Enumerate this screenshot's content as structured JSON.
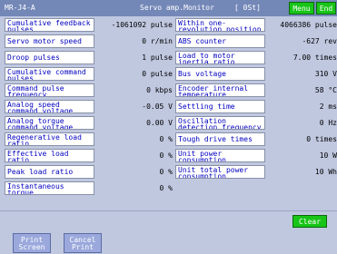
{
  "header": {
    "model": "MR-J4-A",
    "title": "Servo amp.Monitor",
    "status": "[ 0St]",
    "menu_label": "Menu",
    "end_label": "End"
  },
  "left_rows": [
    {
      "label": "Cumulative feedback\npulses",
      "value": "-1061092 pulse"
    },
    {
      "label": "Servo motor speed",
      "value": "0 r/min"
    },
    {
      "label": "Droop pulses",
      "value": "1 pulse"
    },
    {
      "label": "Cumulative command\npulses",
      "value": "0 pulse"
    },
    {
      "label": "Command pulse\nfrequency",
      "value": "0 kbps"
    },
    {
      "label": "Analog speed\ncommand voltage",
      "value": "-0.05 V"
    },
    {
      "label": "Analog torque\ncommand voltage",
      "value": "0.00 V"
    },
    {
      "label": "Regenerative load\nratio",
      "value": "0 %"
    },
    {
      "label": "Effective load\nratio",
      "value": "0 %"
    },
    {
      "label": "Peak load ratio",
      "value": "0 %"
    },
    {
      "label": "Instantaneous\ntorque",
      "value": "0 %"
    }
  ],
  "right_rows": [
    {
      "label": "Within one-\nrevolution position",
      "value": "4066386 pulse"
    },
    {
      "label": "ABS counter",
      "value": "-627 rev"
    },
    {
      "label": "Load to motor\ninertia ratio",
      "value": "7.00 times"
    },
    {
      "label": "Bus voltage",
      "value": "310 V"
    },
    {
      "label": "Encoder internal\ntemperature",
      "value": "58 °C"
    },
    {
      "label": "Settling time",
      "value": "2 ms"
    },
    {
      "label": "Oscillation\ndetection frequency",
      "value": "0 Hz"
    },
    {
      "label": "Tough drive times",
      "value": "0 times"
    },
    {
      "label": "Unit power\nconsumption",
      "value": "10 W"
    },
    {
      "label": "Unit total power\nconsumption",
      "value": "10 Wh"
    }
  ],
  "footer": {
    "clear_label": "Clear",
    "print_screen_label": "Print\nScreen",
    "cancel_print_label": "Cancel\nPrint"
  },
  "colors": {
    "title_bar": "#7488b8",
    "accent_green": "#18c418",
    "label_text": "#0000c0",
    "background": "#c0c8e0"
  }
}
